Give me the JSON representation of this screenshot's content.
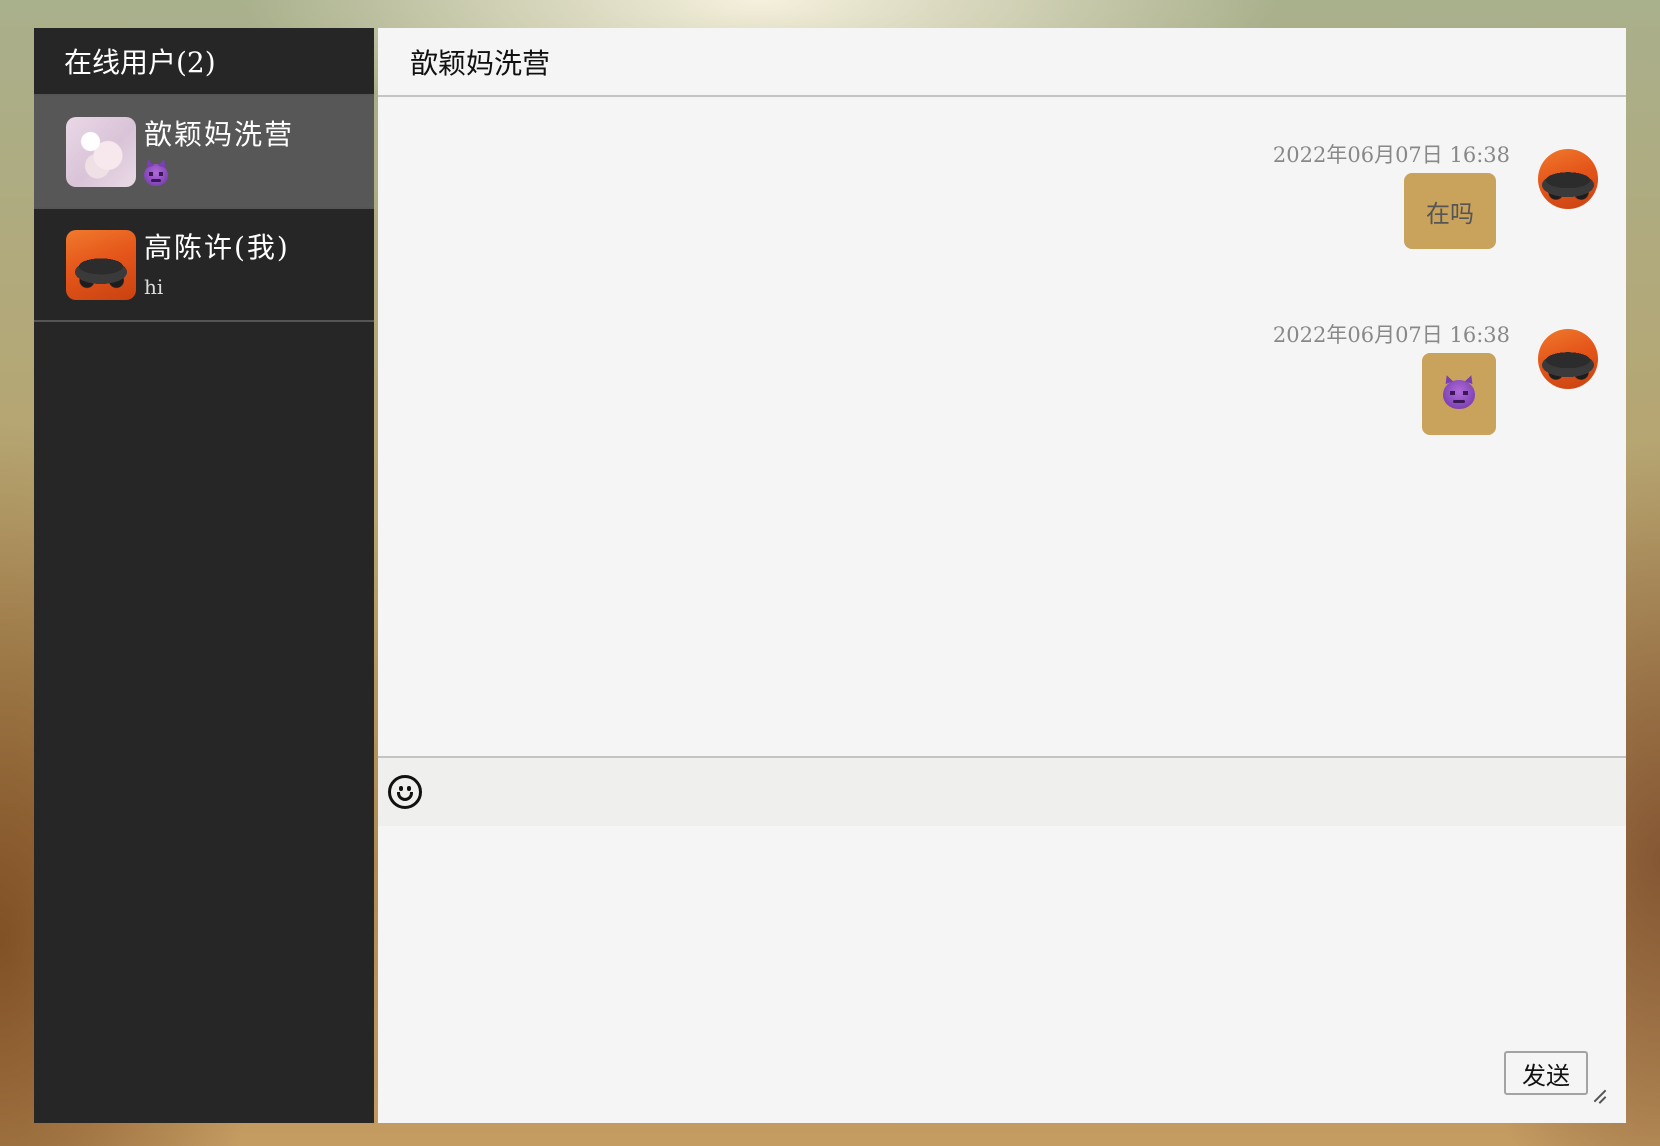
{
  "sidebar": {
    "title": "在线用户(2)",
    "users": [
      {
        "name": "歆颖妈洗营",
        "preview_icon": "devil-emoji-icon",
        "avatar": "flower-avatar",
        "active": true
      },
      {
        "name": "高陈许(我)",
        "preview": "hi",
        "avatar": "car-avatar",
        "active": false
      }
    ]
  },
  "chat": {
    "title": "歆颖妈洗营",
    "messages": [
      {
        "time": "2022年06月07日 16:38",
        "text": "在吗",
        "sender": "self"
      },
      {
        "time": "2022年06月07日 16:38",
        "content_icon": "devil-emoji-icon",
        "sender": "self"
      }
    ]
  },
  "toolbar": {
    "emoji_button": "smiley-icon"
  },
  "composer": {
    "value": "",
    "send_label": "发送"
  },
  "colors": {
    "sidebar_bg": "#262626",
    "sidebar_active": "#575757",
    "chat_bg": "#f5f5f5",
    "bubble": "#c9a25b"
  }
}
